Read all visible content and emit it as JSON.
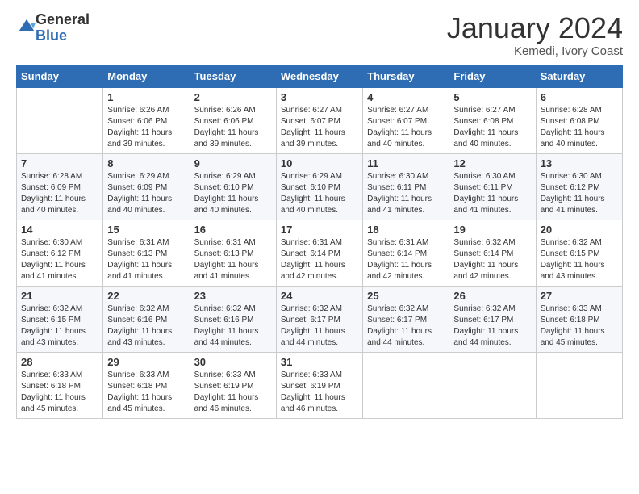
{
  "logo": {
    "general": "General",
    "blue": "Blue"
  },
  "title": "January 2024",
  "location": "Kemedi, Ivory Coast",
  "days_header": [
    "Sunday",
    "Monday",
    "Tuesday",
    "Wednesday",
    "Thursday",
    "Friday",
    "Saturday"
  ],
  "weeks": [
    [
      {
        "day": "",
        "info": ""
      },
      {
        "day": "1",
        "info": "Sunrise: 6:26 AM\nSunset: 6:06 PM\nDaylight: 11 hours\nand 39 minutes."
      },
      {
        "day": "2",
        "info": "Sunrise: 6:26 AM\nSunset: 6:06 PM\nDaylight: 11 hours\nand 39 minutes."
      },
      {
        "day": "3",
        "info": "Sunrise: 6:27 AM\nSunset: 6:07 PM\nDaylight: 11 hours\nand 39 minutes."
      },
      {
        "day": "4",
        "info": "Sunrise: 6:27 AM\nSunset: 6:07 PM\nDaylight: 11 hours\nand 40 minutes."
      },
      {
        "day": "5",
        "info": "Sunrise: 6:27 AM\nSunset: 6:08 PM\nDaylight: 11 hours\nand 40 minutes."
      },
      {
        "day": "6",
        "info": "Sunrise: 6:28 AM\nSunset: 6:08 PM\nDaylight: 11 hours\nand 40 minutes."
      }
    ],
    [
      {
        "day": "7",
        "info": "Sunrise: 6:28 AM\nSunset: 6:09 PM\nDaylight: 11 hours\nand 40 minutes."
      },
      {
        "day": "8",
        "info": "Sunrise: 6:29 AM\nSunset: 6:09 PM\nDaylight: 11 hours\nand 40 minutes."
      },
      {
        "day": "9",
        "info": "Sunrise: 6:29 AM\nSunset: 6:10 PM\nDaylight: 11 hours\nand 40 minutes."
      },
      {
        "day": "10",
        "info": "Sunrise: 6:29 AM\nSunset: 6:10 PM\nDaylight: 11 hours\nand 40 minutes."
      },
      {
        "day": "11",
        "info": "Sunrise: 6:30 AM\nSunset: 6:11 PM\nDaylight: 11 hours\nand 41 minutes."
      },
      {
        "day": "12",
        "info": "Sunrise: 6:30 AM\nSunset: 6:11 PM\nDaylight: 11 hours\nand 41 minutes."
      },
      {
        "day": "13",
        "info": "Sunrise: 6:30 AM\nSunset: 6:12 PM\nDaylight: 11 hours\nand 41 minutes."
      }
    ],
    [
      {
        "day": "14",
        "info": "Sunrise: 6:30 AM\nSunset: 6:12 PM\nDaylight: 11 hours\nand 41 minutes."
      },
      {
        "day": "15",
        "info": "Sunrise: 6:31 AM\nSunset: 6:13 PM\nDaylight: 11 hours\nand 41 minutes."
      },
      {
        "day": "16",
        "info": "Sunrise: 6:31 AM\nSunset: 6:13 PM\nDaylight: 11 hours\nand 41 minutes."
      },
      {
        "day": "17",
        "info": "Sunrise: 6:31 AM\nSunset: 6:14 PM\nDaylight: 11 hours\nand 42 minutes."
      },
      {
        "day": "18",
        "info": "Sunrise: 6:31 AM\nSunset: 6:14 PM\nDaylight: 11 hours\nand 42 minutes."
      },
      {
        "day": "19",
        "info": "Sunrise: 6:32 AM\nSunset: 6:14 PM\nDaylight: 11 hours\nand 42 minutes."
      },
      {
        "day": "20",
        "info": "Sunrise: 6:32 AM\nSunset: 6:15 PM\nDaylight: 11 hours\nand 43 minutes."
      }
    ],
    [
      {
        "day": "21",
        "info": "Sunrise: 6:32 AM\nSunset: 6:15 PM\nDaylight: 11 hours\nand 43 minutes."
      },
      {
        "day": "22",
        "info": "Sunrise: 6:32 AM\nSunset: 6:16 PM\nDaylight: 11 hours\nand 43 minutes."
      },
      {
        "day": "23",
        "info": "Sunrise: 6:32 AM\nSunset: 6:16 PM\nDaylight: 11 hours\nand 44 minutes."
      },
      {
        "day": "24",
        "info": "Sunrise: 6:32 AM\nSunset: 6:17 PM\nDaylight: 11 hours\nand 44 minutes."
      },
      {
        "day": "25",
        "info": "Sunrise: 6:32 AM\nSunset: 6:17 PM\nDaylight: 11 hours\nand 44 minutes."
      },
      {
        "day": "26",
        "info": "Sunrise: 6:32 AM\nSunset: 6:17 PM\nDaylight: 11 hours\nand 44 minutes."
      },
      {
        "day": "27",
        "info": "Sunrise: 6:33 AM\nSunset: 6:18 PM\nDaylight: 11 hours\nand 45 minutes."
      }
    ],
    [
      {
        "day": "28",
        "info": "Sunrise: 6:33 AM\nSunset: 6:18 PM\nDaylight: 11 hours\nand 45 minutes."
      },
      {
        "day": "29",
        "info": "Sunrise: 6:33 AM\nSunset: 6:18 PM\nDaylight: 11 hours\nand 45 minutes."
      },
      {
        "day": "30",
        "info": "Sunrise: 6:33 AM\nSunset: 6:19 PM\nDaylight: 11 hours\nand 46 minutes."
      },
      {
        "day": "31",
        "info": "Sunrise: 6:33 AM\nSunset: 6:19 PM\nDaylight: 11 hours\nand 46 minutes."
      },
      {
        "day": "",
        "info": ""
      },
      {
        "day": "",
        "info": ""
      },
      {
        "day": "",
        "info": ""
      }
    ]
  ]
}
